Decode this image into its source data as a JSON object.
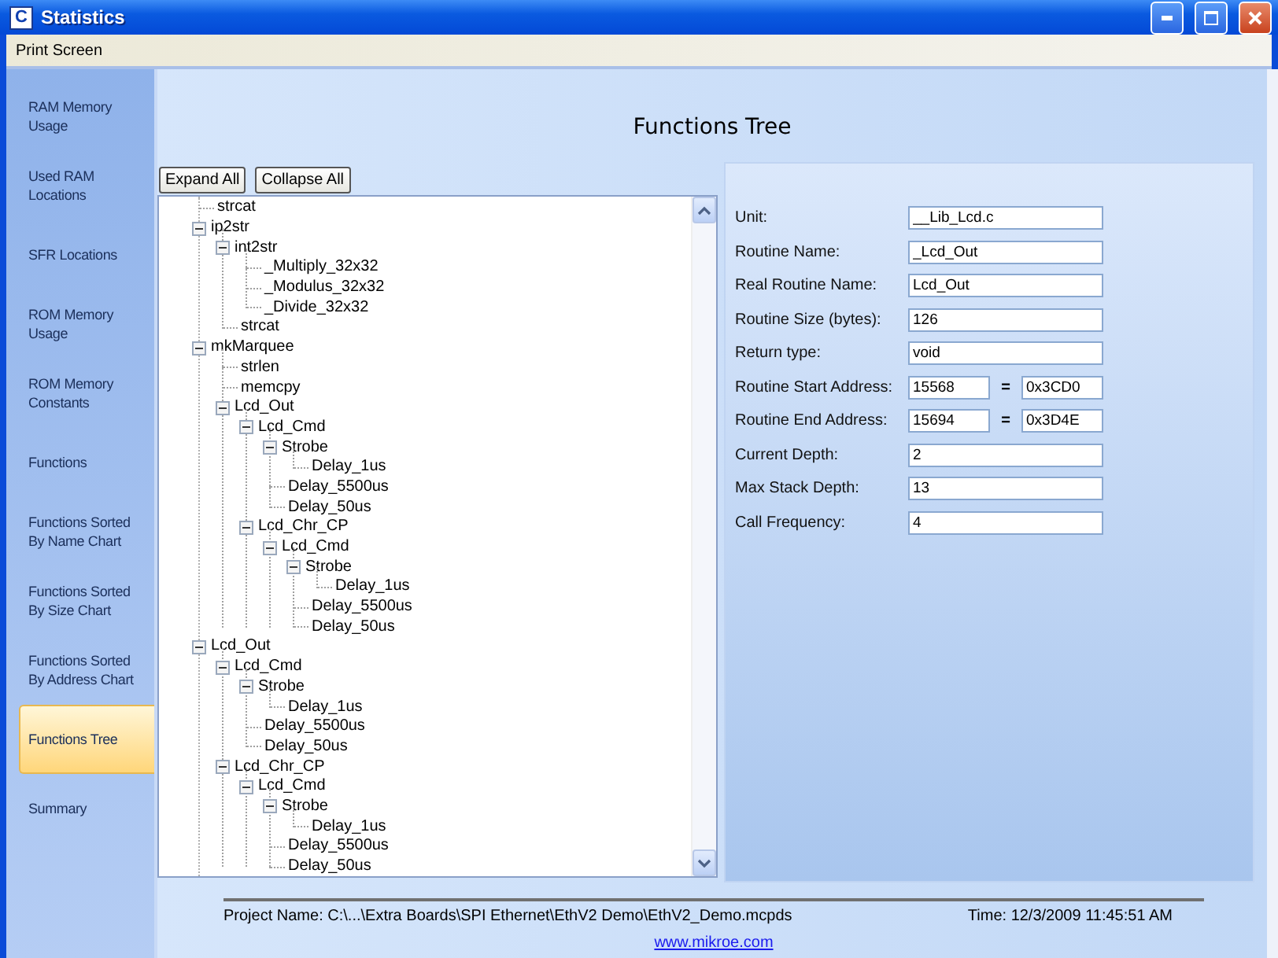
{
  "window": {
    "title": "Statistics",
    "icon_letter": "C"
  },
  "menu": [
    "Print Screen"
  ],
  "sidebar": {
    "items": [
      {
        "label": "RAM Memory Usage",
        "selected": false
      },
      {
        "label": "Used RAM Locations",
        "selected": false
      },
      {
        "label": "SFR Locations",
        "selected": false
      },
      {
        "label": "ROM Memory Usage",
        "selected": false
      },
      {
        "label": "ROM Memory Constants",
        "selected": false
      },
      {
        "label": "Functions",
        "selected": false
      },
      {
        "label": "Functions Sorted By Name Chart",
        "selected": false
      },
      {
        "label": "Functions Sorted By Size Chart",
        "selected": false
      },
      {
        "label": "Functions Sorted By Address Chart",
        "selected": false
      },
      {
        "label": "Functions Tree",
        "selected": true
      },
      {
        "label": "Summary",
        "selected": false
      }
    ]
  },
  "header": {
    "title": "Functions Tree"
  },
  "buttons": [
    "Expand All",
    "Collapse All"
  ],
  "tree": [
    {
      "label": "strcat"
    },
    {
      "label": "ip2str",
      "expanded": true,
      "children": [
        {
          "label": "int2str",
          "expanded": true,
          "children": [
            {
              "label": "_Multiply_32x32"
            },
            {
              "label": "_Modulus_32x32"
            },
            {
              "label": "_Divide_32x32"
            }
          ]
        },
        {
          "label": "strcat"
        }
      ]
    },
    {
      "label": "mkMarquee",
      "expanded": true,
      "children": [
        {
          "label": "strlen"
        },
        {
          "label": "memcpy"
        },
        {
          "label": "Lcd_Out",
          "expanded": true,
          "children": [
            {
              "label": "Lcd_Cmd",
              "expanded": true,
              "children": [
                {
                  "label": "Strobe",
                  "expanded": true,
                  "children": [
                    {
                      "label": "Delay_1us"
                    }
                  ]
                },
                {
                  "label": "Delay_5500us"
                },
                {
                  "label": "Delay_50us"
                }
              ]
            },
            {
              "label": "Lcd_Chr_CP",
              "expanded": true,
              "children": [
                {
                  "label": "Lcd_Cmd",
                  "expanded": true,
                  "children": [
                    {
                      "label": "Strobe",
                      "expanded": true,
                      "children": [
                        {
                          "label": "Delay_1us"
                        }
                      ]
                    },
                    {
                      "label": "Delay_5500us"
                    },
                    {
                      "label": "Delay_50us"
                    }
                  ]
                }
              ]
            }
          ]
        }
      ]
    },
    {
      "label": "Lcd_Out",
      "expanded": true,
      "children": [
        {
          "label": "Lcd_Cmd",
          "expanded": true,
          "children": [
            {
              "label": "Strobe",
              "expanded": true,
              "children": [
                {
                  "label": "Delay_1us"
                }
              ]
            },
            {
              "label": "Delay_5500us"
            },
            {
              "label": "Delay_50us"
            }
          ]
        },
        {
          "label": "Lcd_Chr_CP",
          "expanded": true,
          "children": [
            {
              "label": "Lcd_Cmd",
              "expanded": true,
              "children": [
                {
                  "label": "Strobe",
                  "expanded": true,
                  "children": [
                    {
                      "label": "Delay_1us"
                    }
                  ]
                },
                {
                  "label": "Delay_5500us"
                },
                {
                  "label": "Delay_50us"
                }
              ]
            }
          ]
        }
      ]
    }
  ],
  "details": [
    {
      "kind": "single",
      "label": "Unit:",
      "value": "__Lib_Lcd.c"
    },
    {
      "kind": "single",
      "label": "Routine Name:",
      "value": "_Lcd_Out"
    },
    {
      "kind": "single",
      "label": "Real Routine Name:",
      "value": "Lcd_Out"
    },
    {
      "kind": "single",
      "label": "Routine Size (bytes):",
      "value": "126"
    },
    {
      "kind": "single",
      "label": "Return type:",
      "value": "void"
    },
    {
      "kind": "pair",
      "label": "Routine Start Address:",
      "value": "15568",
      "separator": "=",
      "hex": "0x3CD0"
    },
    {
      "kind": "pair",
      "label": "Routine End Address:",
      "value": "15694",
      "separator": "=",
      "hex": "0x3D4E"
    },
    {
      "kind": "single",
      "label": "Current Depth:",
      "value": "2"
    },
    {
      "kind": "single",
      "label": "Max Stack Depth:",
      "value": "13"
    },
    {
      "kind": "single",
      "label": "Call Frequency:",
      "value": "4"
    }
  ],
  "footer": {
    "project": "Project Name: C:\\...\\Extra Boards\\SPI Ethernet\\EthV2 Demo\\EthV2_Demo.mcpds",
    "time": "Time: 12/3/2009 11:45:51 AM",
    "link": "www.mikroe.com"
  }
}
